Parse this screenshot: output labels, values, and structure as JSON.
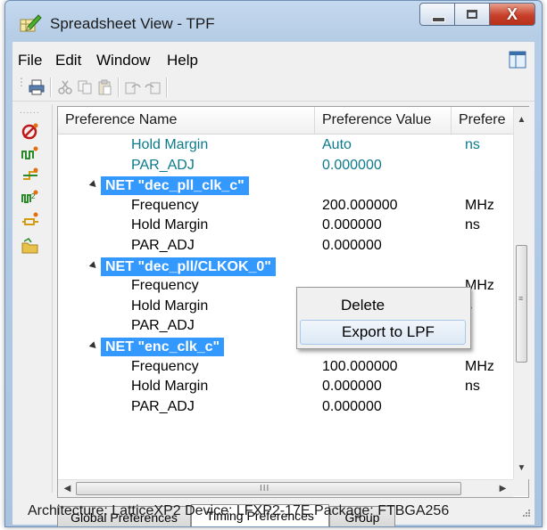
{
  "window": {
    "title": "Spreadsheet View - TPF",
    "close_glyph": "X"
  },
  "menu": [
    "File",
    "Edit",
    "Window",
    "Help"
  ],
  "table": {
    "columns": [
      "Preference Name",
      "Preference Value",
      "Prefere"
    ],
    "rows": [
      {
        "kind": "item",
        "name": "Hold Margin",
        "value": "Auto",
        "unit": "ns",
        "color": "teal"
      },
      {
        "kind": "item",
        "name": "PAR_ADJ",
        "value": "0.000000",
        "unit": "",
        "color": "teal"
      },
      {
        "kind": "group",
        "label": "NET \"dec_pll_clk_c\""
      },
      {
        "kind": "item",
        "name": "Frequency",
        "value": "200.000000",
        "unit": "MHz",
        "color": "black"
      },
      {
        "kind": "item",
        "name": "Hold Margin",
        "value": "0.000000",
        "unit": "ns",
        "color": "black"
      },
      {
        "kind": "item",
        "name": "PAR_ADJ",
        "value": "0.000000",
        "unit": "",
        "color": "black"
      },
      {
        "kind": "group",
        "label": "NET \"dec_pll/CLKOK_0\""
      },
      {
        "kind": "item",
        "name": "Frequency",
        "value": "",
        "unit": "MHz",
        "color": "black"
      },
      {
        "kind": "item",
        "name": "Hold Margin",
        "value": "",
        "unit": "s",
        "color": "black"
      },
      {
        "kind": "item",
        "name": "PAR_ADJ",
        "value": "",
        "unit": "",
        "color": "black"
      },
      {
        "kind": "group",
        "label": "NET \"enc_clk_c\""
      },
      {
        "kind": "item",
        "name": "Frequency",
        "value": "100.000000",
        "unit": "MHz",
        "color": "black"
      },
      {
        "kind": "item",
        "name": "Hold Margin",
        "value": "0.000000",
        "unit": "ns",
        "color": "black"
      },
      {
        "kind": "item",
        "name": "PAR_ADJ",
        "value": "0.000000",
        "unit": "",
        "color": "black"
      }
    ],
    "hscroll_grip": "III"
  },
  "context_menu": {
    "items": [
      "Delete",
      "Export to LPF"
    ]
  },
  "tabs": [
    "Global Preferences",
    "Timing Preferences",
    "Group"
  ],
  "status": {
    "text": "Architecture: LatticeXP2  Device: LFXP2-17E  Package: FTBGA256"
  },
  "colors": {
    "selection": "#3399ff",
    "teal_text": "#0b7a8a"
  },
  "icons": {
    "app": "pencil-spreadsheet-icon",
    "toolbar": [
      "print-icon",
      "cut-icon",
      "copy-icon",
      "paste-icon",
      "undo-icon",
      "redo-icon"
    ],
    "side": [
      "clock-icon",
      "pulse-icon",
      "path-icon",
      "mhz-icon",
      "route-icon",
      "folder-icon"
    ]
  }
}
